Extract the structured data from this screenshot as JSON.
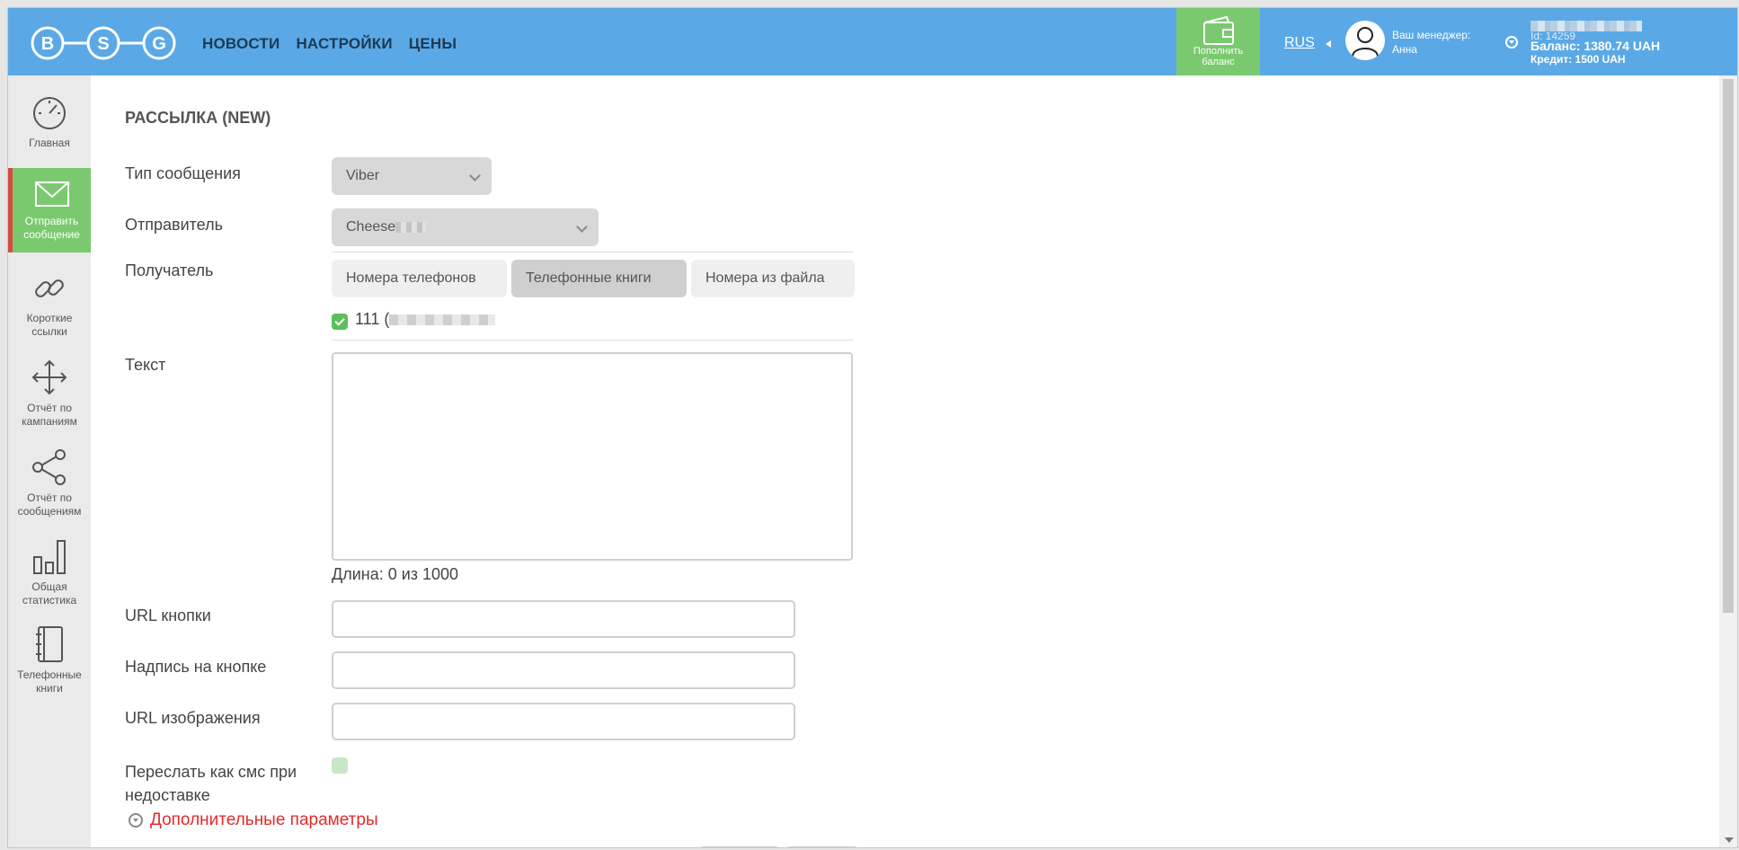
{
  "header": {
    "logo_letters": [
      "B",
      "S",
      "G"
    ],
    "nav": [
      "НОВОСТИ",
      "НАСТРОЙКИ",
      "ЦЕНЫ"
    ],
    "topup_line1": "Пополнить",
    "topup_line2": "баланс",
    "language": "RUS",
    "manager_label": "Ваш менеджер:",
    "manager_name": "Анна",
    "account_id": "Id: 14259",
    "balance_label": "Баланс:",
    "balance_value": "1380.74 UAH",
    "credit_label": "Кредит:",
    "credit_value": "1500 UAH"
  },
  "sidebar": {
    "items": [
      {
        "line1": "Главная",
        "line2": ""
      },
      {
        "line1": "Отправить",
        "line2": "сообщение"
      },
      {
        "line1": "Короткие",
        "line2": "ссылки"
      },
      {
        "line1": "Отчёт по",
        "line2": "кампаниям"
      },
      {
        "line1": "Отчёт по",
        "line2": "сообщениям"
      },
      {
        "line1": "Общая",
        "line2": "статистика"
      },
      {
        "line1": "Телефонные",
        "line2": "книги"
      }
    ]
  },
  "form": {
    "title": "РАССЫЛКА (NEW)",
    "message_type_label": "Тип сообщения",
    "message_type_value": "Viber",
    "sender_label": "Отправитель",
    "sender_value": "Cheese",
    "recipient_label": "Получатель",
    "recipient_tabs": [
      "Номера телефонов",
      "Телефонные книги",
      "Номера из файла"
    ],
    "selected_book": "111 (",
    "text_label": "Текст",
    "length_text": "Длина: 0 из 1000",
    "button_url_label": "URL кнопки",
    "button_caption_label": "Надпись на кнопке",
    "image_url_label": "URL изображения",
    "resend_label_line1": "Переслать как смс при",
    "resend_label_line2": "недоставке",
    "advanced_label": "Дополнительные параметры"
  },
  "colors": {
    "header_bg": "#5aa9e6",
    "accent_green": "#7bc96f",
    "active_marker": "#d94a44",
    "link_red": "#e32b2b"
  }
}
